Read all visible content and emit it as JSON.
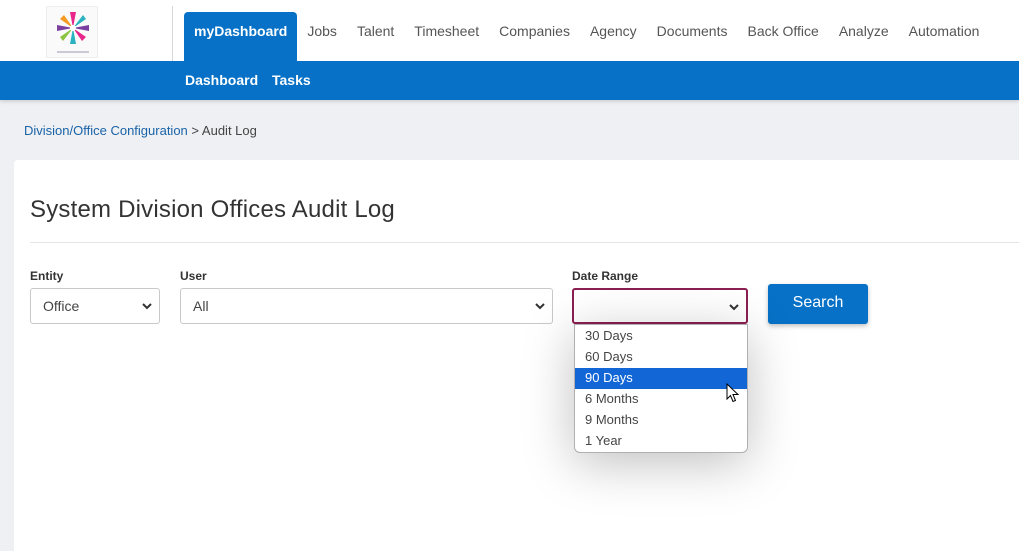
{
  "nav": {
    "items": [
      {
        "label": "myDashboard",
        "active": true
      },
      {
        "label": "Jobs"
      },
      {
        "label": "Talent"
      },
      {
        "label": "Timesheet"
      },
      {
        "label": "Companies"
      },
      {
        "label": "Agency"
      },
      {
        "label": "Documents"
      },
      {
        "label": "Back Office"
      },
      {
        "label": "Analyze"
      },
      {
        "label": "Automation"
      }
    ],
    "sub_items": [
      "Dashboard",
      "Tasks"
    ]
  },
  "breadcrumb": {
    "parent": "Division/Office Configuration",
    "separator": ">",
    "current": "Audit Log"
  },
  "page": {
    "title": "System Division Offices Audit Log"
  },
  "filters": {
    "entity": {
      "label": "Entity",
      "value": "Office"
    },
    "user": {
      "label": "User",
      "value": "All"
    },
    "date_range": {
      "label": "Date Range",
      "value": "",
      "options": [
        "30 Days",
        "60 Days",
        "90 Days",
        "6 Months",
        "9 Months",
        "1 Year"
      ],
      "highlighted": "90 Days"
    },
    "search_label": "Search"
  },
  "colors": {
    "brand_blue": "#0671c6",
    "focus_border": "#8b1f52",
    "option_highlight": "#1266d6"
  }
}
